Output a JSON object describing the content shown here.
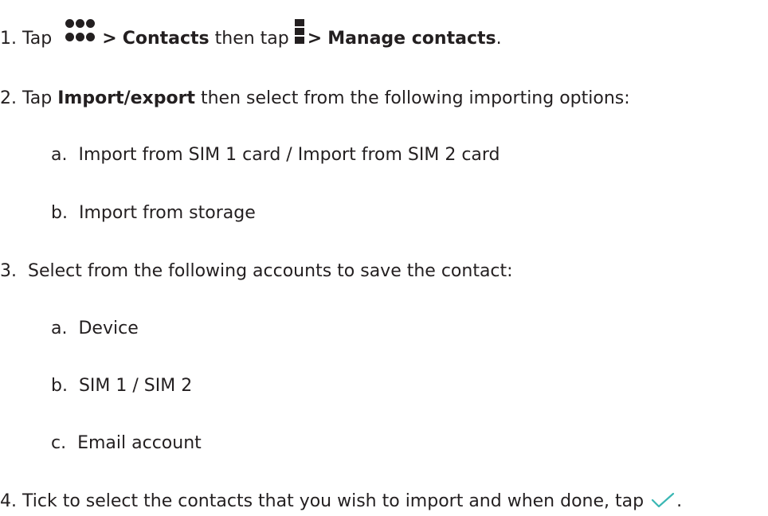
{
  "steps": [
    {
      "num": "1.",
      "t1": "Tap",
      "icon1": "more-dots-icon",
      "arrow1": ">",
      "b1": "Contacts",
      "t2": "then tap",
      "icon2": "menu-vertical-icon",
      "arrow2": ">",
      "b2": "Manage contacts",
      "end": "."
    },
    {
      "num": "2.",
      "t1": "Tap",
      "b1": "Import/export",
      "t2": "then select from the following importing options:",
      "subitems": [
        {
          "letter": "a.",
          "text": "Import from SIM 1 card / Import from SIM 2 card"
        },
        {
          "letter": "b.",
          "text": "Import from storage"
        }
      ]
    },
    {
      "num": "3.",
      "t1": "Select from the following accounts to save the contact:",
      "subitems": [
        {
          "letter": "a.",
          "text": "Device"
        },
        {
          "letter": "b.",
          "text": "SIM 1 / SIM 2"
        },
        {
          "letter": "c.",
          "text": "Email account"
        }
      ]
    },
    {
      "num": "4.",
      "t1": "Tick to select the contacts that you wish to import and when done, tap",
      "icon": "check-icon",
      "end": "."
    }
  ],
  "colors": {
    "text": "#231f20",
    "check_accent": "#3ab7b4"
  }
}
